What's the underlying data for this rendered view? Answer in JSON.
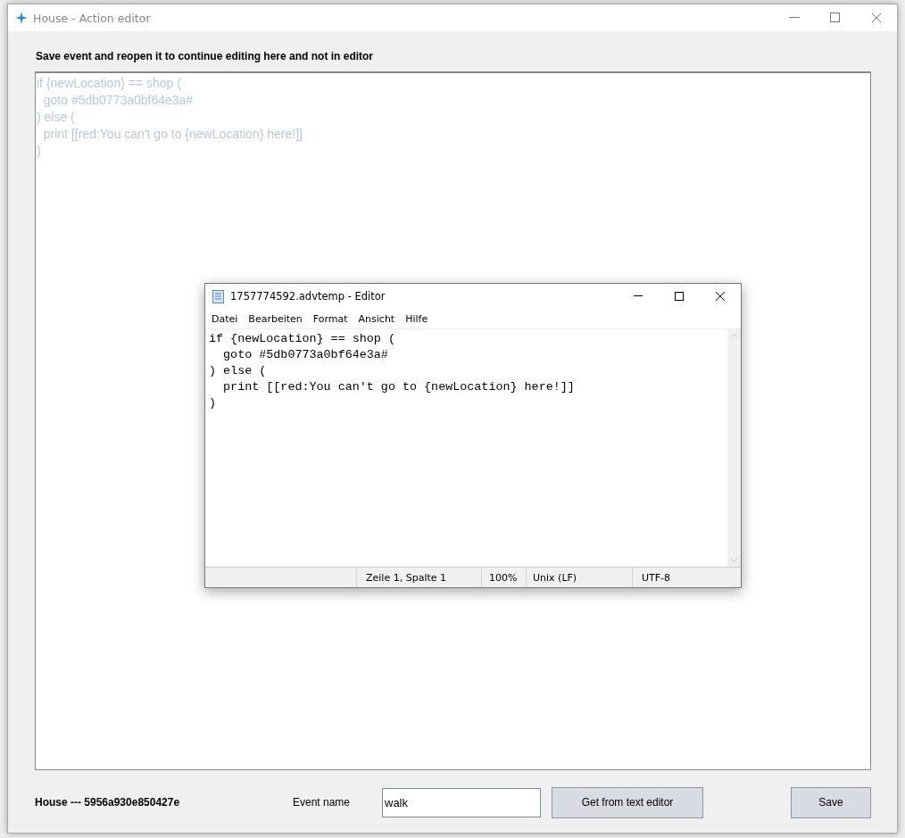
{
  "window": {
    "title": "House - Action editor"
  },
  "notice": "Save event and reopen it to continue editing here and not in editor",
  "script_field": {
    "disabled": true,
    "value": "if {newLocation} == shop (\n  goto #5db0773a0bf64e3a#\n) else (\n  print [[red:You can't go to {newLocation} here!]]\n)"
  },
  "footer": {
    "object_label": "House --- 5956a930e850427e",
    "event_name_label": "Event name",
    "event_name": "walk",
    "buttons": [
      "Get from text editor",
      "Save"
    ]
  },
  "text_editor": {
    "title": "1757774592.advtemp - Editor",
    "menu": [
      "Datei",
      "Bearbeiten",
      "Format",
      "Ansicht",
      "Hilfe"
    ],
    "value": "if {newLocation} == shop (\n  goto #5db0773a0bf64e3a#\n) else (\n  print [[red:You can't go to {newLocation} here!]]\n)",
    "status_bar": [
      "Zeile 1, Spalte 1",
      "100%",
      "Unix (LF)",
      "UTF-8"
    ]
  }
}
